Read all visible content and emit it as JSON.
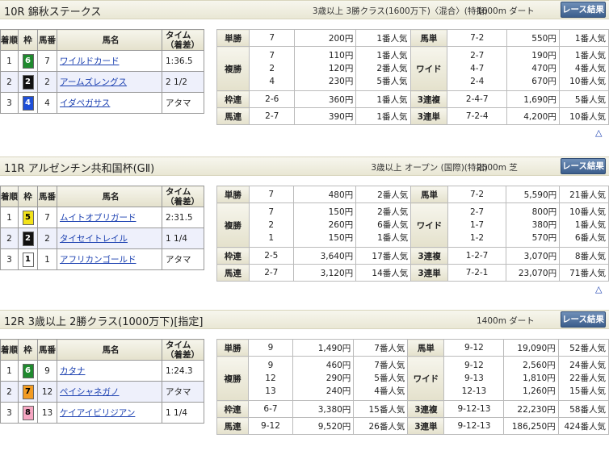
{
  "races": [
    {
      "name": "10R 錦秋ステークス",
      "conditions": "3歳以上 3勝クラス(1600万下)〈混合〉(特指)",
      "distance": "1600m ダート",
      "button": "レース結果",
      "result_headers": {
        "rank": "着順",
        "waku": "枠",
        "num": "馬番",
        "name": "馬名",
        "time": "タイム（着差）"
      },
      "results": [
        {
          "rank": "1",
          "waku": "6",
          "num": "7",
          "horse": "ワイルドカード",
          "time": "1:36.5"
        },
        {
          "rank": "2",
          "waku": "2",
          "num": "2",
          "horse": "アームズレングス",
          "time": "2 1/2"
        },
        {
          "rank": "3",
          "waku": "4",
          "num": "4",
          "horse": "イダペガサス",
          "time": "アタマ"
        }
      ],
      "payouts": {
        "tansho": {
          "label": "単勝",
          "combo": [
            "7"
          ],
          "pay": [
            "200円"
          ],
          "pop": [
            "1番人気"
          ]
        },
        "fukusho": {
          "label": "複勝",
          "combo": [
            "7",
            "2",
            "4"
          ],
          "pay": [
            "110円",
            "120円",
            "230円"
          ],
          "pop": [
            "1番人気",
            "2番人気",
            "5番人気"
          ]
        },
        "wakuren": {
          "label": "枠連",
          "combo": [
            "2-6"
          ],
          "pay": [
            "360円"
          ],
          "pop": [
            "1番人気"
          ]
        },
        "umaren": {
          "label": "馬連",
          "combo": [
            "2-7"
          ],
          "pay": [
            "390円"
          ],
          "pop": [
            "1番人気"
          ]
        },
        "umatan": {
          "label": "馬単",
          "combo": [
            "7-2"
          ],
          "pay": [
            "550円"
          ],
          "pop": [
            "1番人気"
          ]
        },
        "wide": {
          "label": "ワイド",
          "combo": [
            "2-7",
            "4-7",
            "2-4"
          ],
          "pay": [
            "190円",
            "470円",
            "670円"
          ],
          "pop": [
            "1番人気",
            "4番人気",
            "10番人気"
          ]
        },
        "sanrenpuku": {
          "label": "3連複",
          "combo": [
            "2-4-7"
          ],
          "pay": [
            "1,690円"
          ],
          "pop": [
            "5番人気"
          ]
        },
        "sanrentan": {
          "label": "3連単",
          "combo": [
            "7-2-4"
          ],
          "pay": [
            "4,200円"
          ],
          "pop": [
            "10番人気"
          ]
        }
      },
      "top_link": "△"
    },
    {
      "name": "11R アルゼンチン共和国杯(GⅡ)",
      "conditions": "3歳以上 オープン (国際)(特指)",
      "distance": "2500m 芝",
      "button": "レース結果",
      "result_headers": {
        "rank": "着順",
        "waku": "枠",
        "num": "馬番",
        "name": "馬名",
        "time": "タイム（着差）"
      },
      "results": [
        {
          "rank": "1",
          "waku": "5",
          "num": "7",
          "horse": "ムイトオブリガード",
          "time": "2:31.5"
        },
        {
          "rank": "2",
          "waku": "2",
          "num": "2",
          "horse": "タイセイトレイル",
          "time": "1 1/4"
        },
        {
          "rank": "3",
          "waku": "1",
          "num": "1",
          "horse": "アフリカンゴールド",
          "time": "アタマ"
        }
      ],
      "payouts": {
        "tansho": {
          "label": "単勝",
          "combo": [
            "7"
          ],
          "pay": [
            "480円"
          ],
          "pop": [
            "2番人気"
          ]
        },
        "fukusho": {
          "label": "複勝",
          "combo": [
            "7",
            "2",
            "1"
          ],
          "pay": [
            "150円",
            "260円",
            "150円"
          ],
          "pop": [
            "2番人気",
            "6番人気",
            "1番人気"
          ]
        },
        "wakuren": {
          "label": "枠連",
          "combo": [
            "2-5"
          ],
          "pay": [
            "3,640円"
          ],
          "pop": [
            "17番人気"
          ]
        },
        "umaren": {
          "label": "馬連",
          "combo": [
            "2-7"
          ],
          "pay": [
            "3,120円"
          ],
          "pop": [
            "14番人気"
          ]
        },
        "umatan": {
          "label": "馬単",
          "combo": [
            "7-2"
          ],
          "pay": [
            "5,590円"
          ],
          "pop": [
            "21番人気"
          ]
        },
        "wide": {
          "label": "ワイド",
          "combo": [
            "2-7",
            "1-7",
            "1-2"
          ],
          "pay": [
            "800円",
            "380円",
            "570円"
          ],
          "pop": [
            "10番人気",
            "1番人気",
            "6番人気"
          ]
        },
        "sanrenpuku": {
          "label": "3連複",
          "combo": [
            "1-2-7"
          ],
          "pay": [
            "3,070円"
          ],
          "pop": [
            "8番人気"
          ]
        },
        "sanrentan": {
          "label": "3連単",
          "combo": [
            "7-2-1"
          ],
          "pay": [
            "23,070円"
          ],
          "pop": [
            "71番人気"
          ]
        }
      },
      "top_link": "△"
    },
    {
      "name": "12R 3歳以上 2勝クラス(1000万下)[指定]",
      "conditions": "",
      "distance": "1400m ダート",
      "button": "レース結果",
      "result_headers": {
        "rank": "着順",
        "waku": "枠",
        "num": "馬番",
        "name": "馬名",
        "time": "タイム（着差）"
      },
      "results": [
        {
          "rank": "1",
          "waku": "6",
          "num": "9",
          "horse": "カタナ",
          "time": "1:24.3"
        },
        {
          "rank": "2",
          "waku": "7",
          "num": "12",
          "horse": "ペイシャネガノ",
          "time": "アタマ"
        },
        {
          "rank": "3",
          "waku": "8",
          "num": "13",
          "horse": "ケイアイビリジアン",
          "time": "1 1/4"
        }
      ],
      "payouts": {
        "tansho": {
          "label": "単勝",
          "combo": [
            "9"
          ],
          "pay": [
            "1,490円"
          ],
          "pop": [
            "7番人気"
          ]
        },
        "fukusho": {
          "label": "複勝",
          "combo": [
            "9",
            "12",
            "13"
          ],
          "pay": [
            "460円",
            "290円",
            "240円"
          ],
          "pop": [
            "7番人気",
            "5番人気",
            "4番人気"
          ]
        },
        "wakuren": {
          "label": "枠連",
          "combo": [
            "6-7"
          ],
          "pay": [
            "3,380円"
          ],
          "pop": [
            "15番人気"
          ]
        },
        "umaren": {
          "label": "馬連",
          "combo": [
            "9-12"
          ],
          "pay": [
            "9,520円"
          ],
          "pop": [
            "26番人気"
          ]
        },
        "umatan": {
          "label": "馬単",
          "combo": [
            "9-12"
          ],
          "pay": [
            "19,090円"
          ],
          "pop": [
            "52番人気"
          ]
        },
        "wide": {
          "label": "ワイド",
          "combo": [
            "9-12",
            "9-13",
            "12-13"
          ],
          "pay": [
            "2,560円",
            "1,810円",
            "1,260円"
          ],
          "pop": [
            "24番人気",
            "22番人気",
            "15番人気"
          ]
        },
        "sanrenpuku": {
          "label": "3連複",
          "combo": [
            "9-12-13"
          ],
          "pay": [
            "22,230円"
          ],
          "pop": [
            "58番人気"
          ]
        },
        "sanrentan": {
          "label": "3連単",
          "combo": [
            "9-12-13"
          ],
          "pay": [
            "186,250円"
          ],
          "pop": [
            "424番人気"
          ]
        }
      }
    }
  ],
  "waku_colors": {
    "1": {
      "bg": "#ffffff",
      "fg": "#000000"
    },
    "2": {
      "bg": "#111111",
      "fg": "#ffffff"
    },
    "4": {
      "bg": "#1e4fd8",
      "fg": "#ffffff"
    },
    "5": {
      "bg": "#f2e21a",
      "fg": "#000000"
    },
    "6": {
      "bg": "#1f8a2e",
      "fg": "#ffffff"
    },
    "7": {
      "bg": "#f39b21",
      "fg": "#000000"
    },
    "8": {
      "bg": "#f6a6c2",
      "fg": "#000000"
    }
  }
}
